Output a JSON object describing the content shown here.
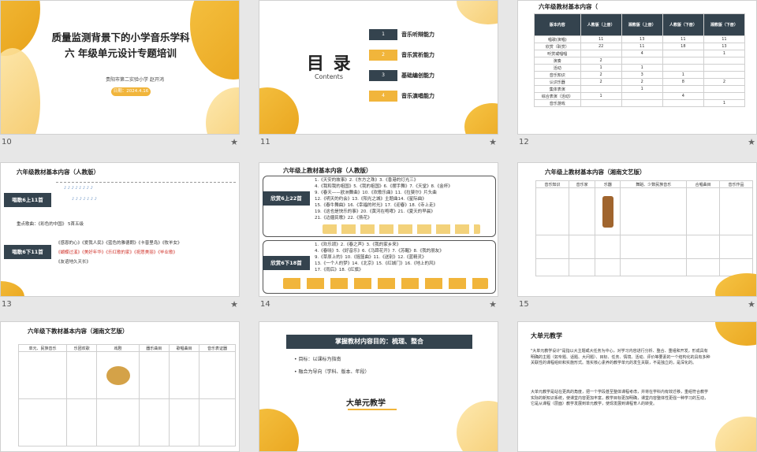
{
  "slides": [
    {
      "number": "10",
      "title": "质量监测背景下的小学音乐学科",
      "title2": "六 年级单元设计专题培训",
      "author": "贵阳市第二实验小学   赵开鸿",
      "date": "日期：2024.4.16"
    },
    {
      "number": "11",
      "title": "目 录",
      "subtitle": "Contents",
      "items": [
        {
          "n": "1",
          "label": "音乐听辩能力"
        },
        {
          "n": "2",
          "label": "音乐赏析能力"
        },
        {
          "n": "3",
          "label": "基础编创能力"
        },
        {
          "n": "4",
          "label": "音乐演唱能力"
        }
      ]
    },
    {
      "number": "12",
      "title": "六年级教材基本内容（",
      "head": [
        "版本内容",
        "人教版（上册）",
        "湘教版（上册）",
        "人教版（下册）",
        "湘教版（下册）"
      ],
      "rows": [
        [
          "唱歌(演唱)",
          "11",
          "13",
          "11",
          "11"
        ],
        [
          "欣赏（聆赏）",
          "22",
          "11",
          "18",
          "13"
        ],
        [
          "听赏或唱唱",
          "",
          "4",
          "",
          "1"
        ],
        [
          "演奏",
          "2",
          "",
          "",
          ""
        ],
        [
          "活动",
          "1",
          "1",
          "",
          ""
        ],
        [
          "音乐知识",
          "2",
          "3",
          "1",
          ""
        ],
        [
          "认识乐器",
          "2",
          "2",
          "8",
          "2"
        ],
        [
          "集体表演",
          "",
          "1",
          "",
          ""
        ],
        [
          "综合表演（活动）",
          "1",
          "",
          "4",
          ""
        ],
        [
          "音乐游戏",
          "",
          "",
          "",
          "1"
        ]
      ]
    },
    {
      "number": "13",
      "title": "六年级教材基本内容（人教版）",
      "label1": "唱歌6上11首",
      "label2": "唱歌6下11首",
      "note": "重点歌曲：《彩色的中国》 5首五级",
      "songs": [
        "《感恩的心》《爱我人民》《蓝色的雅德朗》《卡普里岛》《牧羊女》",
        "《蝴蝶过溪》《美好年华》《乐红歌的家》《祝愿美丽》《毕业歌》",
        "《友谊地久天长》"
      ]
    },
    {
      "number": "14",
      "title": "六年级上教材基本内容（人教版）",
      "label1": "欣赏6上22首",
      "label2": "欣赏6下18首",
      "top": [
        "1.《天安的故事》2.《东方之珠》3.《香港的灯光三》",
        "4.《我和我的祖国》5.《我的祖国》6.《摆手舞》7.《天堂》8.《金杯》",
        "9.《春天——欧洲舞曲》10.《欢歌乐曲》11.《拉斐尔》片头曲",
        "12.《明天的约会》13.《阳光之城》主题曲14.《星际曲》",
        "15.《春牛舞曲》16.《幸福的时光》17.《迎春》18.《寺上走》",
        "19.《这也是快乐的事》20.《黄河在咆哮》21.《夏天的早晨》",
        "21.《边疆民歌》22.《扬花》"
      ],
      "bottom": [
        "1.《欢乐颂》2.《春之声》3.《我的家乡来》",
        "4.《春晓》5.《好音乐》6.《马蹄花开》7.《苏醒》8.《我的朋友》",
        "9.《草原上的》10.《摇篮曲》11.《送别》12.《蓝精灵》",
        "13.《一个人的梦》14.《北京》15.《红城门》16.《地上的风》",
        "17.《雨后》18.《红旗》"
      ]
    },
    {
      "number": "15",
      "title": "六年级上教材基本内容（湘南文艺版）",
      "head": [
        "音乐知识",
        "音乐家",
        "乐器",
        "舞蹈、少数民族音乐",
        "合唱曲目",
        "音乐作品"
      ]
    },
    {
      "number": "",
      "title": "六年级下教材基本内容（湘南文艺版）",
      "head": [
        "单元、民族音乐",
        "乐团欢歌",
        "戏剧",
        "器乐曲目",
        "歌唱曲目",
        "音乐表证器"
      ]
    },
    {
      "number": "",
      "title": "掌握教材内容目的：梳理、整合",
      "b1": "目标：以课标为指南",
      "b2": "融合为导向（学科、版本、年段）",
      "big": "大单元教学"
    },
    {
      "number": "",
      "title": "大单元教学",
      "p1": "\"大单元教学设计\"是指以大主题或大任务为中心，对学习内容进行分析、整合、重组和开发，形成具有明确的主题（如专题、话题、大问题）、目标、任务、情境、活动、评价等要素的一个结构化的具有多种关联性的课程组织和实施形式。落实核心素养的教学单元的发生关联，不是独立的，是深化的。",
      "p2": "大单元教学是站在更高的角度，把一个学段甚至整体课程考虑，并将在学科内有效迁移，重组符合教学实际的新知识系统，使课堂内容更加丰富，教学目标更加明确，课堂内容整体性更强一种学习的互动，它是从课程（层面）教学发展到单元教学，使现发展到课程育人的转变。"
    }
  ],
  "colors": {
    "gold": "#f1b53b",
    "dark": "#34434e",
    "red": "#d0342c"
  }
}
